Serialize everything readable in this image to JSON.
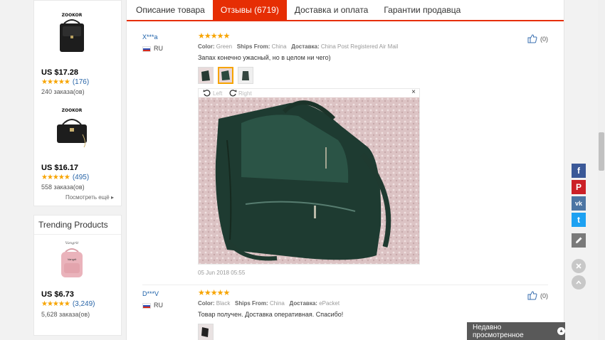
{
  "left_products": [
    {
      "price": "US $17.28",
      "stars": "★★★★★",
      "reviews": "(176)",
      "orders": "240 заказа(ов)"
    },
    {
      "price": "US $16.17",
      "stars": "★★★★★",
      "reviews": "(495)",
      "orders": "558 заказа(ов)"
    }
  ],
  "more_link": "Посмотреть ещё ▸",
  "trending": {
    "title": "Trending Products",
    "product": {
      "price": "US $6.73",
      "stars": "★★★★★",
      "reviews": "(3,249)",
      "orders": "5,628 заказа(ов)"
    }
  },
  "tabs": [
    {
      "label": "Описание товара",
      "active": false
    },
    {
      "label": "Отзывы (6719)",
      "active": true
    },
    {
      "label": "Доставка и оплата",
      "active": false
    },
    {
      "label": "Гарантии продавца",
      "active": false
    }
  ],
  "reviews": [
    {
      "name": "X***a",
      "country": "RU",
      "stars": "★★★★★",
      "color_label": "Color:",
      "color": "Green",
      "ships_label": "Ships From:",
      "ships": "China",
      "delivery_label": "Доставка:",
      "delivery": "China Post Registered Air Mail",
      "text": "Запах конечно ужасный, но в целом ни чего)",
      "helpful": "(0)",
      "viewer": {
        "left": "Left",
        "right": "Right",
        "close": "×"
      },
      "date": "05 Jun 2018 05:55"
    },
    {
      "name": "D***V",
      "country": "RU",
      "stars": "★★★★★",
      "color_label": "Color:",
      "color": "Black",
      "ships_label": "Ships From:",
      "ships": "China",
      "delivery_label": "Доставка:",
      "delivery": "ePacket",
      "text": "Товар получен. Доставка оперативная. Спасибо!",
      "helpful": "(0)"
    }
  ],
  "share": {
    "facebook": "f",
    "pinterest": "P",
    "vk": "vk",
    "twitter": "t"
  },
  "recent": "Недавно просмотренное",
  "colors": {
    "accent": "#e62e04",
    "star": "#f7a400",
    "link": "#1a5fa8"
  }
}
